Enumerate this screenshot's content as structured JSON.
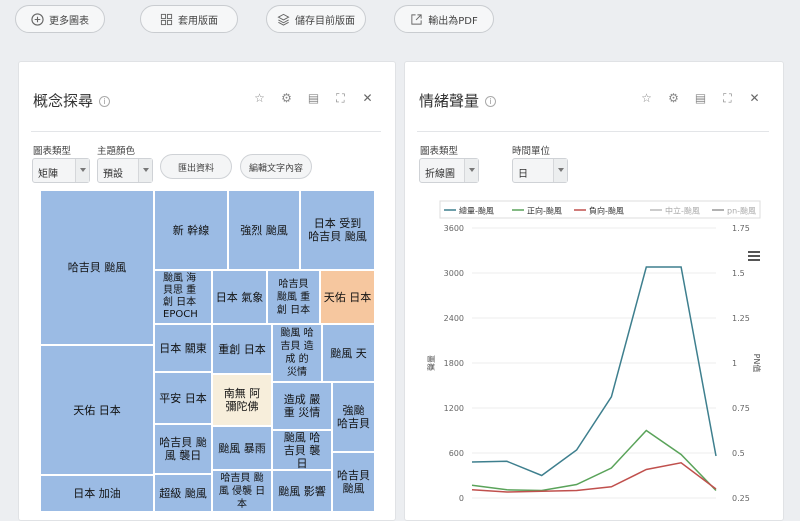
{
  "toolbar": {
    "more_charts": "更多圖表",
    "apply_layout": "套用版面",
    "save_layout": "儲存目前版面",
    "export_pdf": "輸出為PDF"
  },
  "concept_panel": {
    "title": "概念探尋",
    "chart_type_label": "圖表類型",
    "chart_type_value": "矩陣",
    "theme_color_label": "主題顏色",
    "theme_color_value": "預設",
    "export_button": "匯出資料",
    "edit_text_button": "編輯文字內容",
    "treemap_cells": [
      "哈吉貝 颱風",
      "新 幹線",
      "強烈 颱風",
      "日本 受到 哈吉貝 颱風",
      "颱風 海貝思 重創 日本 EPOCH",
      "日本 氣象",
      "哈吉貝 颱風 重創 日本",
      "天佑 日本",
      "日本 關東",
      "重創 日本",
      "颱風 哈吉貝 造成 的 災情",
      "颱風 天",
      "天佑 日本",
      "平安 日本",
      "南無 阿彌陀佛",
      "造成 嚴重 災情",
      "強颱 哈吉貝",
      "哈吉貝 颱風 襲日",
      "颱風 暴雨",
      "颱風 哈吉貝 襲日",
      "日本 加油",
      "哈吉貝 颱風",
      "超級 颱風",
      "哈吉貝 颱風 侵襲 日本",
      "颱風 影響",
      "哈吉貝 颱風"
    ]
  },
  "sentiment_panel": {
    "title": "情緒聲量",
    "chart_type_label": "圖表類型",
    "chart_type_value": "折線圖",
    "time_unit_label": "時間單位",
    "time_unit_value": "日",
    "chart_data": {
      "type": "line",
      "legend_position": "top",
      "legend": [
        "總量-颱風",
        "正向-颱風",
        "負向-颱風",
        "中立-颱風",
        "pn-颱風"
      ],
      "ylabel": "聲量",
      "y2label": "PN值",
      "ylim": [
        0,
        3600
      ],
      "y2lim": [
        0.25,
        1.75
      ],
      "y_ticks": [
        "0",
        "600",
        "1200",
        "1800",
        "2400",
        "3000",
        "3600"
      ],
      "y2_ticks": [
        "0.25",
        "0.5",
        "0.75",
        "1",
        "1.25",
        "1.5",
        "1.75"
      ],
      "series": [
        {
          "name": "總量-颱風",
          "color": "#3e7f8e",
          "values": [
            480,
            490,
            300,
            640,
            1350,
            3080,
            3080,
            560
          ]
        },
        {
          "name": "正向-颱風",
          "color": "#5aa35a",
          "values": [
            170,
            110,
            100,
            180,
            400,
            900,
            580,
            100
          ]
        },
        {
          "name": "負向-颱風",
          "color": "#c0504d",
          "values": [
            110,
            80,
            90,
            100,
            150,
            380,
            470,
            120
          ]
        }
      ]
    }
  },
  "colors": {
    "cell_blue": "#9bbbe4",
    "cell_orange": "#f6c79f",
    "cell_cream": "#f7eedb"
  }
}
